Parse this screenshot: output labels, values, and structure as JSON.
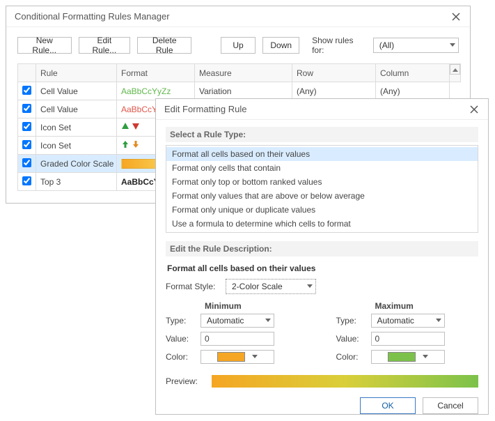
{
  "mgr": {
    "title": "Conditional Formatting Rules Manager",
    "buttons": {
      "new": "New Rule...",
      "edit": "Edit Rule...",
      "delete": "Delete Rule",
      "up": "Up",
      "down": "Down"
    },
    "show_rules_label": "Show rules for:",
    "show_rules_value": "(All)",
    "columns": {
      "rule": "Rule",
      "format": "Format",
      "measure": "Measure",
      "row": "Row",
      "column": "Column"
    },
    "rows": [
      {
        "rule": "Cell Value",
        "fmtKind": "text",
        "fmtClass": "fmt-green",
        "fmtText": "AaBbCcYyZz",
        "measure": "Variation",
        "row": "(Any)",
        "column": "(Any)",
        "selected": false
      },
      {
        "rule": "Cell Value",
        "fmtKind": "text",
        "fmtClass": "fmt-red",
        "fmtText": "AaBbCcYy",
        "measure": "",
        "row": "",
        "column": "",
        "selected": false
      },
      {
        "rule": "Icon Set",
        "fmtKind": "arrows-filled",
        "fmtText": "",
        "measure": "",
        "row": "",
        "column": "",
        "selected": false
      },
      {
        "rule": "Icon Set",
        "fmtKind": "arrows-outline",
        "fmtText": "",
        "measure": "",
        "row": "",
        "column": "",
        "selected": false
      },
      {
        "rule": "Graded Color Scale",
        "fmtKind": "gradient",
        "fmtText": "",
        "measure": "",
        "row": "",
        "column": "",
        "selected": true
      },
      {
        "rule": "Top 3",
        "fmtKind": "text",
        "fmtClass": "fmt-bold",
        "fmtText": "AaBbCcY",
        "measure": "",
        "row": "",
        "column": "",
        "selected": false
      }
    ]
  },
  "edit": {
    "title": "Edit Formatting Rule",
    "select_label": "Select a Rule Type:",
    "rule_types": [
      "Format all cells based on their values",
      "Format only cells that contain",
      "Format only top or bottom ranked values",
      "Format only values that are above or below average",
      "Format only unique or duplicate values",
      "Use a formula to determine which cells to format"
    ],
    "selected_rule_type_index": 0,
    "desc_label": "Edit the Rule Description:",
    "desc_title": "Format all cells based on their values",
    "format_style_label": "Format Style:",
    "format_style_value": "2-Color Scale",
    "min_label": "Minimum",
    "max_label": "Maximum",
    "type_label": "Type:",
    "value_label": "Value:",
    "color_label": "Color:",
    "min": {
      "type": "Automatic",
      "value": "0",
      "color": "#f5a623"
    },
    "max": {
      "type": "Automatic",
      "value": "0",
      "color": "#7cc24a"
    },
    "preview_label": "Preview:",
    "ok": "OK",
    "cancel": "Cancel"
  }
}
